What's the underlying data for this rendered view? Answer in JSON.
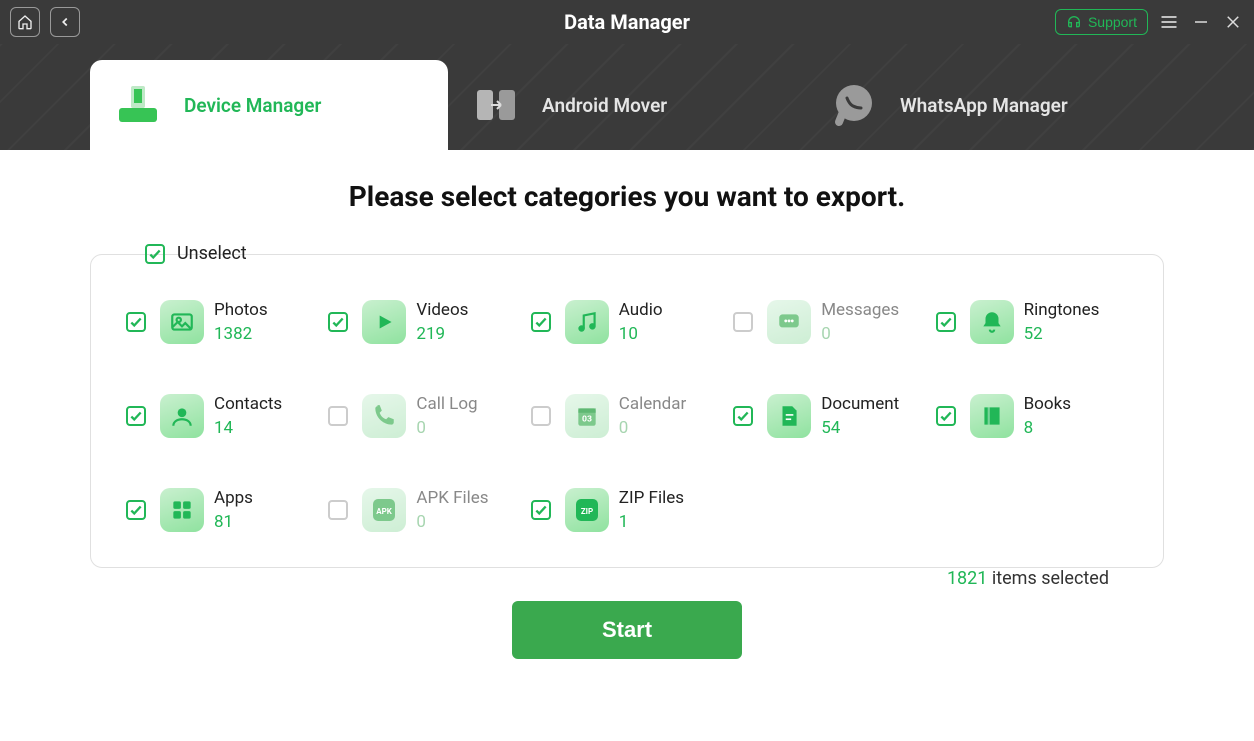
{
  "window": {
    "title": "Data Manager",
    "support_label": "Support"
  },
  "tabs": [
    {
      "label": "Device Manager",
      "active": true
    },
    {
      "label": "Android Mover",
      "active": false
    },
    {
      "label": "WhatsApp Manager",
      "active": false
    }
  ],
  "headline": "Please select categories you want to export.",
  "unselect_label": "Unselect",
  "categories": [
    {
      "id": "photos",
      "label": "Photos",
      "count": "1382",
      "checked": true
    },
    {
      "id": "videos",
      "label": "Videos",
      "count": "219",
      "checked": true
    },
    {
      "id": "audio",
      "label": "Audio",
      "count": "10",
      "checked": true
    },
    {
      "id": "messages",
      "label": "Messages",
      "count": "0",
      "checked": false
    },
    {
      "id": "ringtones",
      "label": "Ringtones",
      "count": "52",
      "checked": true
    },
    {
      "id": "contacts",
      "label": "Contacts",
      "count": "14",
      "checked": true
    },
    {
      "id": "calllog",
      "label": "Call Log",
      "count": "0",
      "checked": false
    },
    {
      "id": "calendar",
      "label": "Calendar",
      "count": "0",
      "checked": false
    },
    {
      "id": "document",
      "label": "Document",
      "count": "54",
      "checked": true
    },
    {
      "id": "books",
      "label": "Books",
      "count": "8",
      "checked": true
    },
    {
      "id": "apps",
      "label": "Apps",
      "count": "81",
      "checked": true
    },
    {
      "id": "apkfiles",
      "label": "APK Files",
      "count": "0",
      "checked": false
    },
    {
      "id": "zipfiles",
      "label": "ZIP Files",
      "count": "1",
      "checked": true
    }
  ],
  "summary": {
    "count": "1821",
    "suffix": " items selected"
  },
  "start_label": "Start"
}
